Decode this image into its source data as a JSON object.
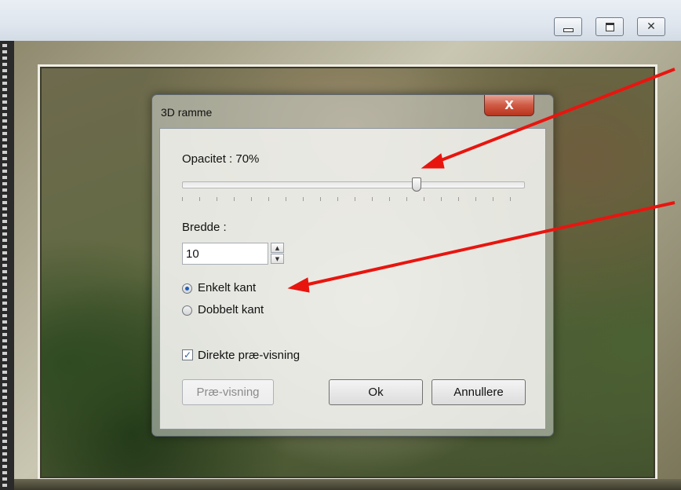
{
  "window_controls": {
    "minimize_icon": "minimize-icon",
    "maximize_icon": "maximize-icon",
    "close_icon": "close-icon"
  },
  "dialog": {
    "title": "3D ramme",
    "close_glyph": "X",
    "opacity": {
      "label": "Opacitet : 70%",
      "value_percent": 70
    },
    "width": {
      "label": "Bredde :",
      "value": "10"
    },
    "border_style": {
      "options": [
        {
          "label": "Enkelt kant",
          "checked": true
        },
        {
          "label": "Dobbelt kant",
          "checked": false
        }
      ]
    },
    "live_preview": {
      "label": "Direkte præ-visning",
      "checked": true,
      "check_glyph": "✓"
    },
    "buttons": {
      "preview": "Præ-visning",
      "ok": "Ok",
      "cancel": "Annullere"
    }
  },
  "annotation_color": "#e8150f"
}
